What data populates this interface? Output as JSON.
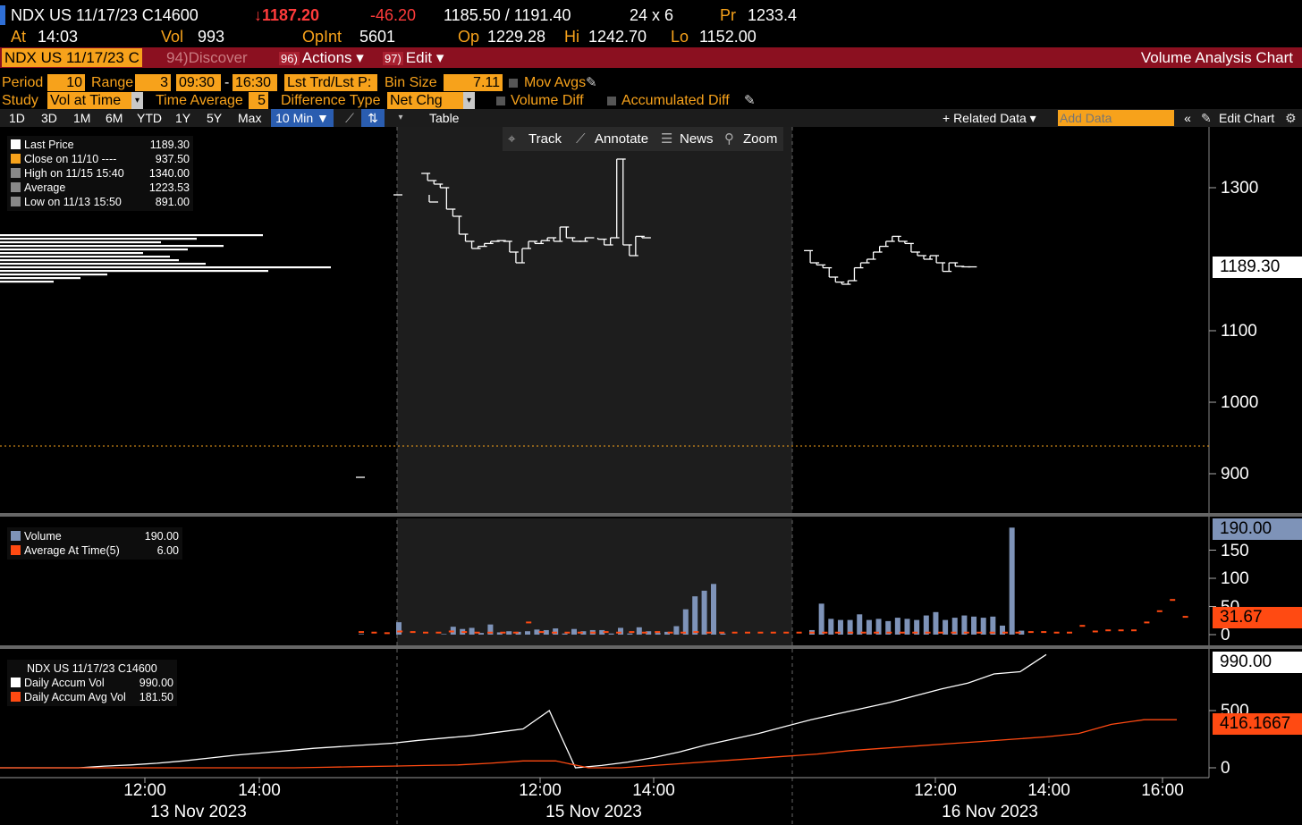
{
  "header": {
    "ticker": "NDX US 11/17/23 C14600",
    "last": "↓1187.20",
    "change": "-46.20",
    "bid_ask": "1185.50 / 1191.40",
    "size": "24 x 6",
    "pr_label": "Pr",
    "pr_value": "1233.4",
    "at_label": "At",
    "at_value": "14:03",
    "vol_label": "Vol",
    "vol_value": "993",
    "opint_label": "OpInt",
    "opint_value": "5601",
    "op_label": "Op",
    "op_value": "1229.28",
    "hi_label": "Hi",
    "hi_value": "1242.70",
    "lo_label": "Lo",
    "lo_value": "1152.00"
  },
  "menubar": {
    "ticker_box": "NDX US 11/17/23 C",
    "discover_num": "94)",
    "discover": "Discover",
    "actions_num": "96)",
    "actions": "Actions ▾",
    "edit_num": "97)",
    "edit": "Edit ▾",
    "title": "Volume Analysis Chart"
  },
  "settings": {
    "period_label": "Period",
    "period_value": "10",
    "range_label": "Range",
    "range_value": "3",
    "time_start": "09:30",
    "time_sep": "-",
    "time_end": "16:30",
    "lst_field": "Lst Trd/Lst P:",
    "bin_label": "Bin Size",
    "bin_value": "7.11",
    "movavg_label": "Mov Avgs",
    "study_label": "Study",
    "study_value": "Vol at Time",
    "timeavg_label": "Time Average",
    "timeavg_value": "5",
    "difftype_label": "Difference Type",
    "difftype_value": "Net Chg",
    "voldiff_label": "Volume Diff",
    "accdiff_label": "Accumulated Diff"
  },
  "toolbar": {
    "ranges": [
      "1D",
      "3D",
      "1M",
      "6M",
      "YTD",
      "1Y",
      "5Y",
      "Max"
    ],
    "interval": "10 Min ▼",
    "table": "Table",
    "related": "+ Related Data ▾",
    "add_data_placeholder": "Add Data",
    "edit_chart": "Edit Chart"
  },
  "tools": {
    "track": "Track",
    "annotate": "Annotate",
    "news": "News",
    "zoom": "Zoom"
  },
  "colors": {
    "orange": "#f7a21b",
    "volume_bar": "#7e93b8",
    "average": "#ff4a12",
    "menubar": "#8b1020"
  },
  "price_legend": [
    {
      "label": "Last Price",
      "value": "1189.30"
    },
    {
      "label": "Close on 11/10 ----",
      "value": "937.50"
    },
    {
      "label": "High on 11/15 15:40",
      "value": "1340.00"
    },
    {
      "label": "Average",
      "value": "1223.53"
    },
    {
      "label": "Low on 11/13 15:50",
      "value": "891.00"
    }
  ],
  "volume_legend": [
    {
      "label": "Volume",
      "value": "190.00"
    },
    {
      "label": "Average At Time(5)",
      "value": "6.00"
    }
  ],
  "accum_legend": {
    "title": "NDX US 11/17/23 C14600",
    "rows": [
      {
        "label": "Daily Accum Vol",
        "value": "990.00"
      },
      {
        "label": "Daily Accum Avg Vol",
        "value": "181.50"
      }
    ]
  },
  "price_axis": {
    "ticks": [
      "1300",
      "1100",
      "1000",
      "900"
    ],
    "last_tag": "1189.30"
  },
  "volume_axis": {
    "ticks": [
      "150",
      "100",
      "50",
      "0"
    ],
    "volume_tag": "190.00",
    "avg_tag": "31.67"
  },
  "accum_axis": {
    "ticks": [
      "500",
      "0"
    ],
    "vol_tag": "990.00",
    "avg_tag": "416.1667"
  },
  "x_axis": {
    "times": [
      "12:00",
      "14:00",
      "12:00",
      "14:00",
      "12:00",
      "14:00",
      "16:00"
    ],
    "dates": [
      "13 Nov 2023",
      "15 Nov 2023",
      "16 Nov 2023"
    ]
  },
  "chart_data": [
    {
      "type": "line",
      "title": "",
      "xlabel": "",
      "ylabel": "",
      "ylim": [
        880,
        1350
      ],
      "series": [
        {
          "name": "Last Price",
          "x": [
            "11/13 15:50",
            "11/14 09:30",
            "11/14 11:00",
            "11/15 10:00",
            "11/15 10:10",
            "11/15 10:20",
            "11/15 10:30",
            "11/15 10:40",
            "11/15 10:50",
            "11/15 11:00",
            "11/15 11:10",
            "11/15 11:20",
            "11/15 11:30",
            "11/15 11:40",
            "11/15 11:50",
            "11/15 12:00",
            "11/15 12:10",
            "11/15 12:20",
            "11/15 12:30",
            "11/15 12:40",
            "11/15 12:50",
            "11/15 13:00",
            "11/15 13:10",
            "11/15 13:20",
            "11/15 13:30",
            "11/15 13:40",
            "11/15 13:50",
            "11/15 14:00",
            "11/15 14:10",
            "11/15 14:20",
            "11/15 14:40",
            "11/15 14:50",
            "11/15 15:00",
            "11/15 15:10",
            "11/15 15:20",
            "11/15 15:30",
            "11/15 15:40",
            "11/15 15:50",
            "11/16 09:40",
            "11/16 09:50",
            "11/16 10:00",
            "11/16 10:10",
            "11/16 10:20",
            "11/16 10:30",
            "11/16 10:40",
            "11/16 10:50",
            "11/16 11:00",
            "11/16 11:10",
            "11/16 11:20",
            "11/16 11:30",
            "11/16 11:40",
            "11/16 11:50",
            "11/16 12:00",
            "11/16 12:10",
            "11/16 12:20",
            "11/16 12:30",
            "11/16 12:40",
            "11/16 12:50",
            "11/16 13:00",
            "11/16 13:10",
            "11/16 13:20",
            "11/16 13:30",
            "11/16 13:40",
            "11/16 13:50",
            "11/16 14:00"
          ],
          "values": [
            895,
            1290,
            1280,
            1320,
            1310,
            1305,
            1300,
            1270,
            1260,
            1235,
            1225,
            1215,
            1218,
            1222,
            1225,
            1226,
            1225,
            1210,
            1195,
            1215,
            1225,
            1222,
            1226,
            1230,
            1225,
            1245,
            1230,
            1225,
            1225,
            1230,
            1228,
            1220,
            1230,
            1340,
            1220,
            1205,
            1232,
            1230,
            1212,
            1195,
            1192,
            1188,
            1175,
            1168,
            1165,
            1170,
            1188,
            1195,
            1200,
            1210,
            1218,
            1225,
            1232,
            1225,
            1222,
            1210,
            1205,
            1200,
            1205,
            1195,
            1183,
            1195,
            1190,
            1189.3,
            1189.3
          ]
        }
      ]
    },
    {
      "type": "bar",
      "title": "",
      "ylim": [
        0,
        200
      ],
      "series": [
        {
          "name": "Volume",
          "values": [
            1,
            22,
            1,
            14,
            10,
            12,
            3,
            18,
            4,
            6,
            5,
            6,
            9,
            8,
            11,
            2,
            10,
            6,
            8,
            8,
            2,
            12,
            2,
            13,
            6,
            3,
            5,
            15,
            45,
            68,
            78,
            90,
            2,
            8,
            55,
            28,
            26,
            26,
            36,
            26,
            28,
            24,
            30,
            28,
            26,
            34,
            40,
            26,
            30,
            34,
            32,
            30,
            32,
            16,
            190,
            7
          ]
        },
        {
          "name": "Average At Time(5)",
          "values": [
            3,
            2,
            1,
            4,
            3,
            2,
            2,
            4,
            3,
            2,
            2,
            2,
            2,
            20,
            3,
            2,
            2,
            2,
            2,
            3,
            2,
            3,
            2,
            3,
            2,
            2,
            3,
            2,
            2,
            2,
            2,
            2,
            2,
            2,
            2,
            2,
            2,
            2,
            2,
            2,
            2,
            2,
            2,
            2,
            2,
            2,
            2,
            2,
            2,
            2,
            2,
            2,
            3,
            3,
            2,
            2,
            14,
            4,
            6,
            6,
            6,
            20,
            40,
            60,
            30
          ]
        }
      ]
    },
    {
      "type": "line",
      "title": "",
      "ylim": [
        0,
        1000
      ],
      "series": [
        {
          "name": "Daily Accum Vol",
          "values": [
            0,
            0,
            0,
            0,
            15,
            25,
            40,
            60,
            85,
            110,
            130,
            150,
            170,
            185,
            200,
            215,
            240,
            260,
            280,
            310,
            340,
            500,
            0,
            20,
            50,
            90,
            140,
            200,
            250,
            300,
            360,
            420,
            470,
            520,
            570,
            630,
            690,
            740,
            820,
            840,
            990
          ]
        },
        {
          "name": "Daily Accum Avg Vol",
          "values": [
            0,
            0,
            0,
            0,
            0,
            0,
            0,
            0,
            0,
            0,
            5,
            10,
            15,
            20,
            25,
            40,
            60,
            60,
            0,
            0,
            20,
            40,
            60,
            80,
            100,
            120,
            150,
            170,
            190,
            210,
            230,
            250,
            270,
            300,
            380,
            420,
            420
          ]
        }
      ]
    }
  ]
}
